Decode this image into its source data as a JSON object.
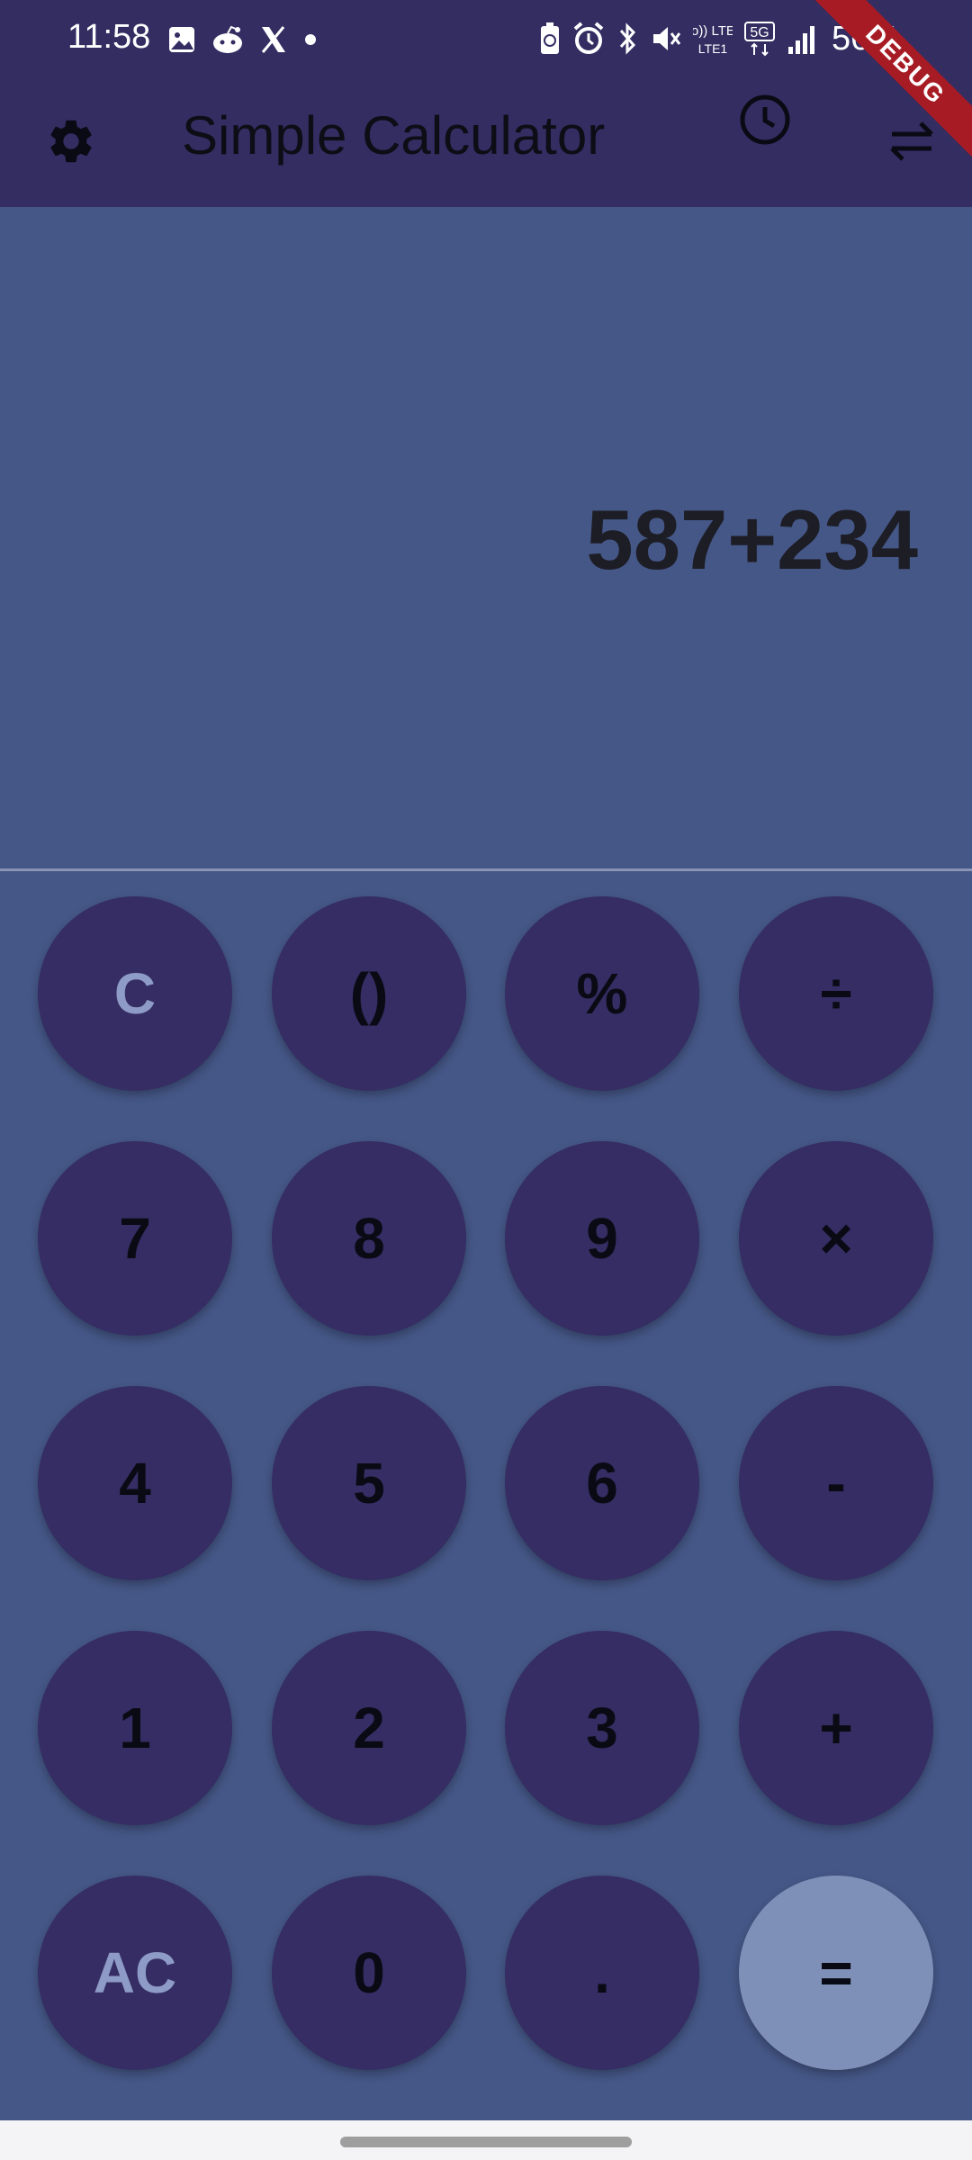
{
  "status_bar": {
    "time": "11:58",
    "battery": "56%",
    "left_icons": [
      "gallery-icon",
      "reddit-icon",
      "x-icon",
      "dot-icon"
    ],
    "right_icons": [
      "battery-saver-icon",
      "alarm-icon",
      "bluetooth-icon",
      "mute-icon",
      "volte-icon",
      "5g-icon",
      "signal-icon"
    ],
    "volte_label": "Vo)) LTE1",
    "network_label": "5G"
  },
  "debug_banner": "DEBUG",
  "app_bar": {
    "title": "Simple Calculator",
    "icons": [
      "settings-icon",
      "history-icon",
      "swap-icon"
    ]
  },
  "display": {
    "expression": "587+234"
  },
  "keypad": {
    "rows": [
      [
        {
          "label": "C",
          "style": "muted"
        },
        {
          "label": "()",
          "style": "normal"
        },
        {
          "label": "%",
          "style": "normal"
        },
        {
          "label": "÷",
          "style": "normal"
        }
      ],
      [
        {
          "label": "7",
          "style": "normal"
        },
        {
          "label": "8",
          "style": "normal"
        },
        {
          "label": "9",
          "style": "normal"
        },
        {
          "label": "×",
          "style": "normal"
        }
      ],
      [
        {
          "label": "4",
          "style": "normal"
        },
        {
          "label": "5",
          "style": "normal"
        },
        {
          "label": "6",
          "style": "normal"
        },
        {
          "label": "-",
          "style": "normal"
        }
      ],
      [
        {
          "label": "1",
          "style": "normal"
        },
        {
          "label": "2",
          "style": "normal"
        },
        {
          "label": "3",
          "style": "normal"
        },
        {
          "label": "+",
          "style": "normal"
        }
      ],
      [
        {
          "label": "AC",
          "style": "muted"
        },
        {
          "label": "0",
          "style": "normal"
        },
        {
          "label": ".",
          "style": "normal"
        },
        {
          "label": "=",
          "style": "equals"
        }
      ]
    ]
  },
  "colors": {
    "header_bg": "#332d62",
    "body_bg": "#455787",
    "key_bg": "#352d63",
    "equals_bg": "#7f90b8",
    "muted_text": "#8d9bc6",
    "debug_banner": "#a71c24"
  }
}
